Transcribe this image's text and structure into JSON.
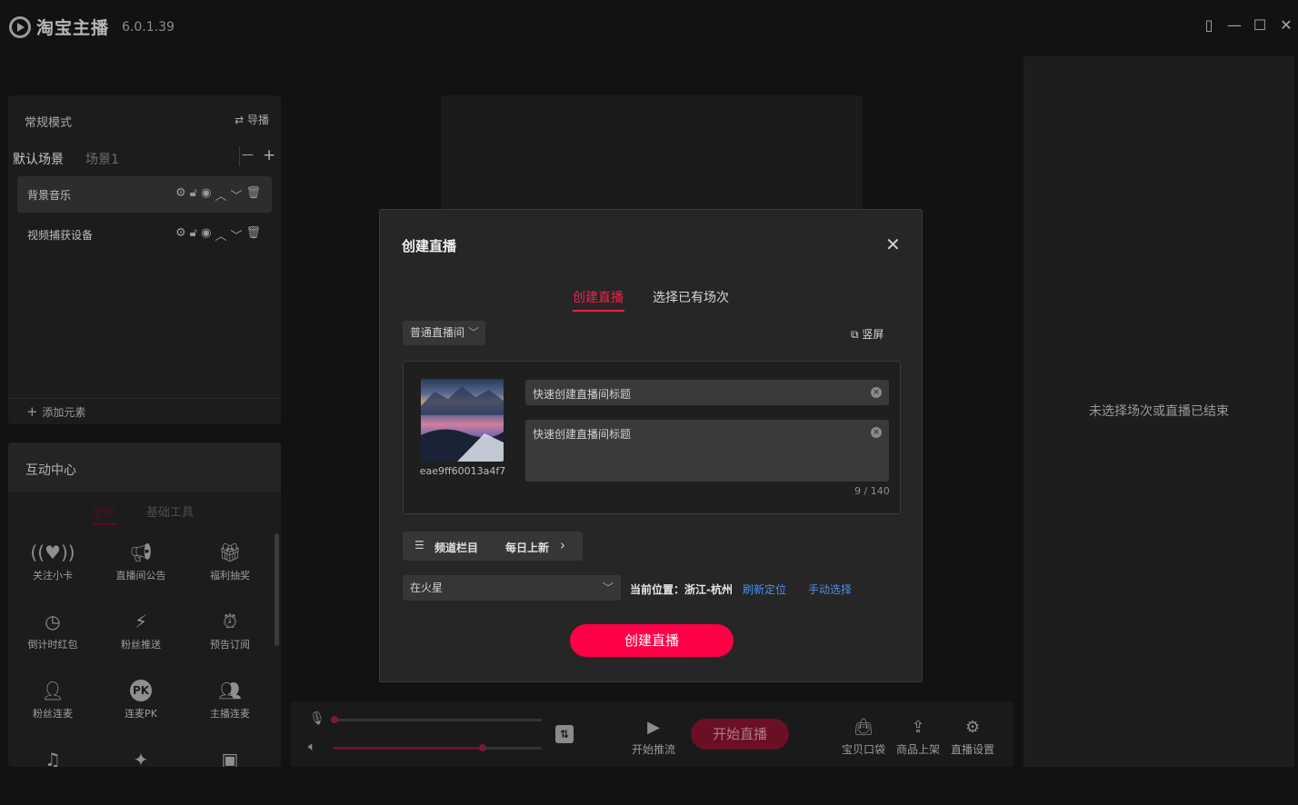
{
  "app": {
    "name": "淘宝主播",
    "version": "6.0.1.39"
  },
  "window_controls": {
    "file": "▯",
    "minimize": "—",
    "maximize": "☐",
    "close": "✕"
  },
  "scene_panel": {
    "mode": "常规模式",
    "guide_label": "导播",
    "tabs": [
      "默认场景",
      "场景1"
    ],
    "tab_minus": "—",
    "tab_plus": "+",
    "sources": [
      "背景音乐",
      "视频捕获设备"
    ],
    "add_element": "添加元素"
  },
  "interaction_center": {
    "title": "互动中心",
    "tabs": [
      "全部",
      "基础工具"
    ],
    "tools": [
      {
        "label": "关注小卡",
        "icon": "broadcast-heart-icon"
      },
      {
        "label": "直播间公告",
        "icon": "megaphone-icon"
      },
      {
        "label": "福利抽奖",
        "icon": "gift-icon"
      },
      {
        "label": "倒计时红包",
        "icon": "timer-icon"
      },
      {
        "label": "粉丝推送",
        "icon": "flash-icon"
      },
      {
        "label": "预告订阅",
        "icon": "alarm-clock-icon"
      },
      {
        "label": "粉丝连麦",
        "icon": "user-mic-icon"
      },
      {
        "label": "连麦PK",
        "icon": "pk-icon"
      },
      {
        "label": "主播连麦",
        "icon": "anchor-mic-icon"
      },
      {
        "label": "",
        "icon": "music-note-icon"
      },
      {
        "label": "",
        "icon": "star-effect-icon"
      },
      {
        "label": "",
        "icon": "robot-icon"
      }
    ]
  },
  "right_panel": {
    "message": "未选择场次或直播已结束"
  },
  "bottom_bar": {
    "mic_level": 0.0,
    "volume_level": 0.71,
    "start_push": "开始推流",
    "start_live": "开始直播",
    "tools": [
      "宝贝口袋",
      "商品上架",
      "直播设置"
    ]
  },
  "modal": {
    "title": "创建直播",
    "tabs": [
      "创建直播",
      "选择已有场次"
    ],
    "room_type": "普通直播间",
    "portrait_label": "竖屏",
    "cover_id": "eae9ff60013a4f7",
    "title_placeholder": "快速创建直播间标题",
    "desc_placeholder": "快速创建直播间标题",
    "char_count": "9 / 140",
    "channel_label": "频道栏目",
    "channel_value": "每日上新",
    "location_value": "在火星",
    "current_location": "当前位置：浙江-杭州",
    "refresh_location": "刷新定位",
    "manual_select": "手动选择",
    "submit": "创建直播"
  },
  "colors": {
    "accent": "#ff0046",
    "link": "#4d8fe6",
    "background": "#121212"
  }
}
